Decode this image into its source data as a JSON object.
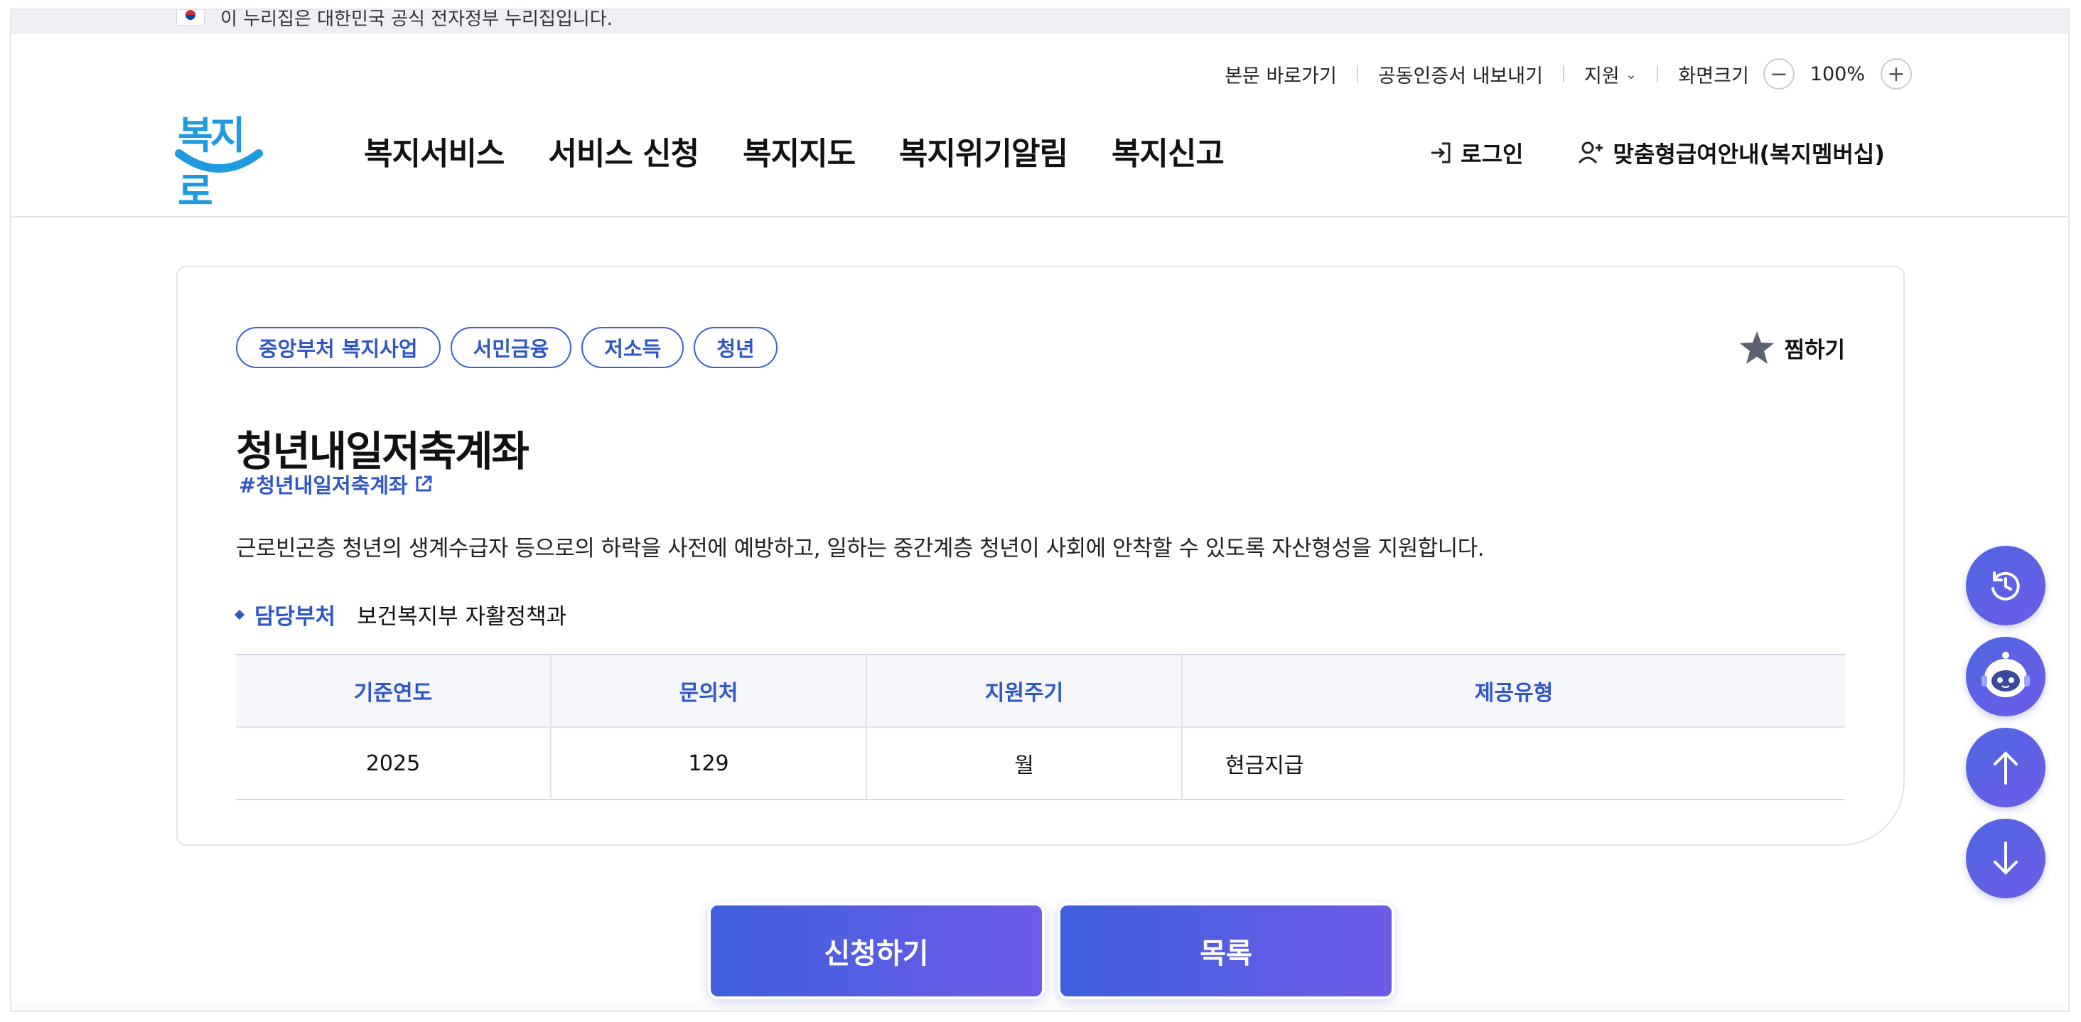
{
  "gov_banner": {
    "text": "이 누리집은 대한민국 공식 전자정부 누리집입니다."
  },
  "utility": {
    "skip_link": "본문 바로가기",
    "cert_export": "공동인증서 내보내기",
    "support": "지원",
    "screen_size_label": "화면크기",
    "zoom_value": "100%"
  },
  "logo": {
    "text": "복지로"
  },
  "nav": {
    "items": [
      {
        "label": "복지서비스"
      },
      {
        "label": "서비스 신청"
      },
      {
        "label": "복지지도"
      },
      {
        "label": "복지위기알림"
      },
      {
        "label": "복지신고"
      }
    ]
  },
  "header_right": {
    "login": "로그인",
    "membership": "맞춤형급여안내(복지멤버십)"
  },
  "detail": {
    "tags": [
      {
        "label": "중앙부처 복지사업"
      },
      {
        "label": "서민금융"
      },
      {
        "label": "저소득"
      },
      {
        "label": "청년"
      }
    ],
    "favorite_label": "찜하기",
    "title": "청년내일저축계좌",
    "hashtag": "#청년내일저축계좌",
    "description": "근로빈곤층 청년의 생계수급자 등으로의 하락을 사전에 예방하고, 일하는 중간계층 청년이 사회에 안착할 수 있도록 자산형성을 지원합니다.",
    "department_label": "담당부처",
    "department_value": "보건복지부 자활정책과",
    "table": {
      "headers": [
        "기준연도",
        "문의처",
        "지원주기",
        "제공유형"
      ],
      "row": [
        "2025",
        "129",
        "월",
        "현금지급"
      ]
    }
  },
  "buttons": {
    "apply": "신청하기",
    "list": "목록"
  },
  "colors": {
    "accent": "#2f56c6",
    "button_gradient_start": "#3f5fdc",
    "button_gradient_end": "#6d5ce8",
    "logo": "#1e9be0"
  }
}
